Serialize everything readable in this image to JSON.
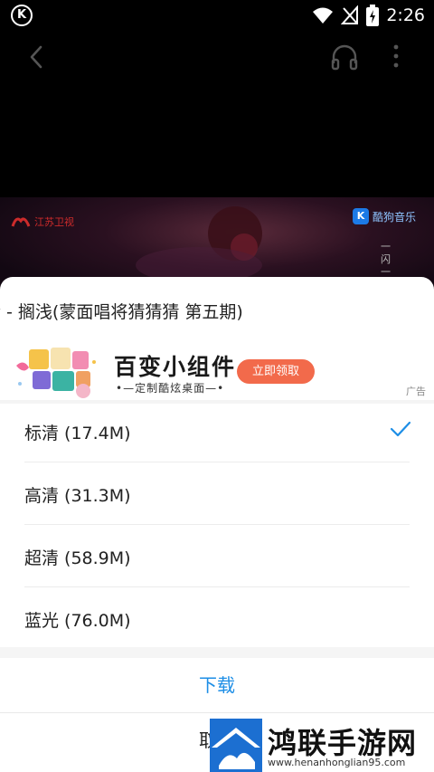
{
  "status_bar": {
    "app_icon": "K",
    "time": "2:26"
  },
  "video": {
    "tv_channel": "江苏卫视",
    "watermark_brand": "酷狗音乐",
    "lyric_fragment": "一闪一"
  },
  "sheet": {
    "title": "猜 - 搁浅(蒙面唱将猜猜猜 第五期)",
    "ad": {
      "title": "百变小组件",
      "subtitle": "•—定制酷炫桌面—•",
      "button": "立即领取",
      "tag": "广告"
    },
    "qualities": [
      {
        "label": "标清 (17.4M)",
        "selected": true
      },
      {
        "label": "高清 (31.3M)",
        "selected": false
      },
      {
        "label": "超清 (58.9M)",
        "selected": false
      },
      {
        "label": "蓝光 (76.0M)",
        "selected": false
      }
    ],
    "download_label": "下载",
    "cancel_label": "取消"
  },
  "site_watermark": {
    "name": "鸿联手游网",
    "url": "www.henanhonglian95.com"
  },
  "colors": {
    "accent": "#1d8ee6",
    "ad_button": "#f26a4b",
    "check": "#1d8ee6"
  }
}
